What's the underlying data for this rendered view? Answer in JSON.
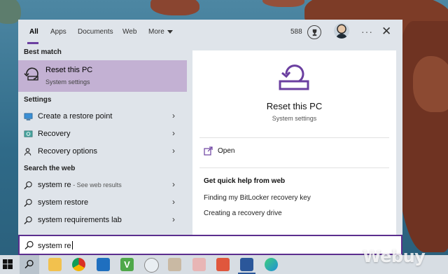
{
  "colors": {
    "accent": "#6b3fa0",
    "selected_row": "#c3b1d3",
    "panel_bg": "#dfe4ea"
  },
  "header": {
    "tabs": [
      {
        "label": "All",
        "active": true
      },
      {
        "label": "Apps"
      },
      {
        "label": "Documents"
      },
      {
        "label": "Web"
      },
      {
        "label": "More"
      }
    ],
    "points": "588",
    "icons": [
      "trophy-icon",
      "avatar",
      "more-options-icon",
      "close-icon"
    ]
  },
  "best_match": {
    "section_label": "Best match",
    "title": "Reset this PC",
    "subtitle": "System settings",
    "icon": "reset-pc-icon"
  },
  "settings": {
    "section_label": "Settings",
    "items": [
      {
        "label": "Create a restore point",
        "icon": "monitor-icon"
      },
      {
        "label": "Recovery",
        "icon": "recovery-icon"
      },
      {
        "label": "Recovery options",
        "icon": "person-icon"
      }
    ]
  },
  "web": {
    "section_label": "Search the web",
    "items": [
      {
        "label": "system re",
        "suffix": " - See web results",
        "icon": "search-icon"
      },
      {
        "label": "system restore",
        "icon": "search-icon"
      },
      {
        "label": "system requirements lab",
        "icon": "search-icon"
      }
    ]
  },
  "detail": {
    "title": "Reset this PC",
    "subtitle": "System settings",
    "open_label": "Open",
    "quick_help_label": "Get quick help from web",
    "links": [
      "Finding my BitLocker recovery key",
      "Creating a recovery drive"
    ]
  },
  "search": {
    "value": "system re"
  },
  "taskbar": {
    "icons": [
      "windows-start-icon",
      "search-icon",
      "file-explorer-icon",
      "chrome-icon",
      "store-icon",
      "veeam-icon",
      "magnifier-icon",
      "paint-icon",
      "snip-icon",
      "paint-3d-icon",
      "word-icon",
      "edge-icon"
    ]
  },
  "watermark": "Webuy"
}
